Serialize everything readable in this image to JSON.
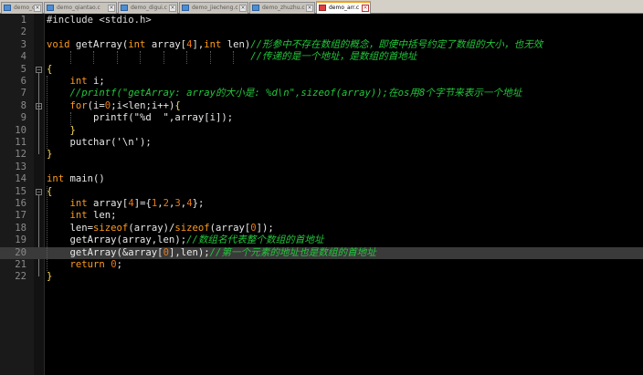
{
  "colors": {
    "background": "#000000",
    "gutter": "#1a1a1a",
    "line_number": "#8a8a8a",
    "keyword": "#ff9a1a",
    "number": "#e87a1a",
    "comment": "#23c83c",
    "current_line": "#3a3a3a",
    "active_tab_accent": "#f39c12"
  },
  "tabs": [
    {
      "label": "demo_c",
      "active": false,
      "icon": "document-icon"
    },
    {
      "label": "demo_qiantao.c",
      "active": false,
      "icon": "document-icon"
    },
    {
      "label": "demo_digui.c",
      "active": false,
      "icon": "document-icon"
    },
    {
      "label": "demo_jiecheng.c",
      "active": false,
      "icon": "document-icon"
    },
    {
      "label": "demo_zhuzhu.c",
      "active": false,
      "icon": "document-icon"
    },
    {
      "label": "demo_arr.c",
      "active": true,
      "icon": "document-icon"
    }
  ],
  "tab_close_glyph": "×",
  "fold_glyph": "−",
  "current_line": 20,
  "lines": [
    {
      "n": "1",
      "tokens": [
        [
          "pp",
          "#include <stdio.h>"
        ]
      ]
    },
    {
      "n": "2",
      "tokens": []
    },
    {
      "n": "3",
      "tokens": [
        [
          "kw",
          "void"
        ],
        [
          "pl",
          " getArray("
        ],
        [
          "kw",
          "int"
        ],
        [
          "pl",
          " array["
        ],
        [
          "num",
          "4"
        ],
        [
          "pl",
          "],"
        ],
        [
          "kw",
          "int"
        ],
        [
          "pl",
          " len)"
        ],
        [
          "cmt",
          "//形参中不存在数组的概念，即使中括号约定了数组的大小，也无效"
        ]
      ]
    },
    {
      "n": "4",
      "tokens": [
        [
          "pl",
          "                                   "
        ],
        [
          "cmt",
          "//传递的是一个地址，是数组的首地址"
        ]
      ]
    },
    {
      "n": "5",
      "tokens": [
        [
          "brk",
          "{"
        ]
      ],
      "fold": true
    },
    {
      "n": "6",
      "tokens": [
        [
          "pl",
          "    "
        ],
        [
          "kw",
          "int"
        ],
        [
          "pl",
          " i;"
        ]
      ]
    },
    {
      "n": "7",
      "tokens": [
        [
          "pl",
          "    "
        ],
        [
          "cmt",
          "//printf(\"getArray: array的大小是: %d\\n\",sizeof(array));在os用8个字节来表示一个地址"
        ]
      ]
    },
    {
      "n": "8",
      "tokens": [
        [
          "pl",
          "    "
        ],
        [
          "kw",
          "for"
        ],
        [
          "pl",
          "(i="
        ],
        [
          "num",
          "0"
        ],
        [
          "pl",
          ";i<len;i++)"
        ],
        [
          "brk",
          "{"
        ]
      ],
      "fold": true
    },
    {
      "n": "9",
      "tokens": [
        [
          "pl",
          "        printf(\"%d  \",array[i]);"
        ]
      ]
    },
    {
      "n": "10",
      "tokens": [
        [
          "pl",
          "    "
        ],
        [
          "brk",
          "}"
        ]
      ]
    },
    {
      "n": "11",
      "tokens": [
        [
          "pl",
          "    putchar('\\n');"
        ]
      ]
    },
    {
      "n": "12",
      "tokens": [
        [
          "brk",
          "}"
        ]
      ]
    },
    {
      "n": "13",
      "tokens": []
    },
    {
      "n": "14",
      "tokens": [
        [
          "kw",
          "int"
        ],
        [
          "pl",
          " main()"
        ]
      ]
    },
    {
      "n": "15",
      "tokens": [
        [
          "brk",
          "{"
        ]
      ],
      "fold": true
    },
    {
      "n": "16",
      "tokens": [
        [
          "pl",
          "    "
        ],
        [
          "kw",
          "int"
        ],
        [
          "pl",
          " array["
        ],
        [
          "num",
          "4"
        ],
        [
          "pl",
          "]={"
        ],
        [
          "num",
          "1"
        ],
        [
          "pl",
          ","
        ],
        [
          "num",
          "2"
        ],
        [
          "pl",
          ","
        ],
        [
          "num",
          "3"
        ],
        [
          "pl",
          ","
        ],
        [
          "num",
          "4"
        ],
        [
          "pl",
          "};"
        ]
      ]
    },
    {
      "n": "17",
      "tokens": [
        [
          "pl",
          "    "
        ],
        [
          "kw",
          "int"
        ],
        [
          "pl",
          " len;"
        ]
      ]
    },
    {
      "n": "18",
      "tokens": [
        [
          "pl",
          "    len="
        ],
        [
          "kw",
          "sizeof"
        ],
        [
          "pl",
          "(array)/"
        ],
        [
          "kw",
          "sizeof"
        ],
        [
          "pl",
          "(array["
        ],
        [
          "num",
          "0"
        ],
        [
          "pl",
          "]);"
        ]
      ]
    },
    {
      "n": "19",
      "tokens": [
        [
          "pl",
          "    getArray(array,len);"
        ],
        [
          "cmt",
          "//数组名代表整个数组的首地址"
        ]
      ]
    },
    {
      "n": "20",
      "tokens": [
        [
          "pl",
          "    getArray(&array["
        ],
        [
          "num",
          "0"
        ],
        [
          "pl",
          "],len);"
        ],
        [
          "cmt",
          "//第一个元素的地址也是数组的首地址"
        ]
      ]
    },
    {
      "n": "21",
      "tokens": [
        [
          "pl",
          "    "
        ],
        [
          "kw",
          "return"
        ],
        [
          "pl",
          " "
        ],
        [
          "num",
          "0"
        ],
        [
          "pl",
          ";"
        ]
      ]
    },
    {
      "n": "22",
      "tokens": [
        [
          "brk",
          "}"
        ]
      ]
    }
  ]
}
